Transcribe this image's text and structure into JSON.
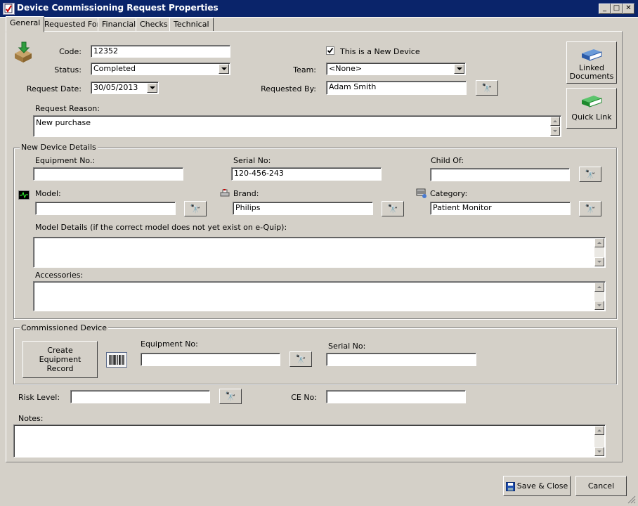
{
  "window": {
    "title": "Device Commissioning Request  Properties"
  },
  "tabs": [
    {
      "label": "General"
    },
    {
      "label": "Requested For"
    },
    {
      "label": "Financial"
    },
    {
      "label": "Checks"
    },
    {
      "label": "Technical"
    }
  ],
  "general": {
    "code_label": "Code:",
    "code": "12352",
    "status_label": "Status:",
    "status": "Completed",
    "request_date_label": "Request Date:",
    "request_date": "30/05/2013",
    "new_device_label": "This is a New Device",
    "new_device_checked": true,
    "team_label": "Team:",
    "team": "<None>",
    "requested_by_label": "Requested By:",
    "requested_by": "Adam Smith",
    "request_reason_label": "Request Reason:",
    "request_reason": "New purchase"
  },
  "side_buttons": {
    "linked_documents": "Linked Documents",
    "quick_link": "Quick Link"
  },
  "new_device": {
    "group_title": "New Device Details",
    "equipment_no_label": "Equipment No.:",
    "equipment_no": "",
    "serial_no_label": "Serial No:",
    "serial_no": "120-456-243",
    "child_of_label": "Child Of:",
    "child_of": "",
    "model_label": "Model:",
    "model": "",
    "brand_label": "Brand:",
    "brand": "Philips",
    "category_label": "Category:",
    "category": "Patient Monitor",
    "model_details_label": "Model Details (if the correct model does not yet exist on e-Quip):",
    "model_details": "",
    "accessories_label": "Accessories:",
    "accessories": ""
  },
  "commissioned": {
    "group_title": "Commissioned Device",
    "create_button": "Create Equipment Record",
    "equipment_no_label": "Equipment No:",
    "equipment_no": "",
    "serial_no_label": "Serial No:",
    "serial_no": ""
  },
  "misc": {
    "risk_level_label": "Risk Level:",
    "risk_level": "",
    "ce_no_label": "CE No:",
    "ce_no": "",
    "notes_label": "Notes:",
    "notes": ""
  },
  "footer": {
    "save_close": "Save & Close",
    "cancel": "Cancel"
  },
  "icons": {
    "find": "binoculars-icon",
    "barcode": "barcode-icon",
    "app": "form-icon"
  }
}
